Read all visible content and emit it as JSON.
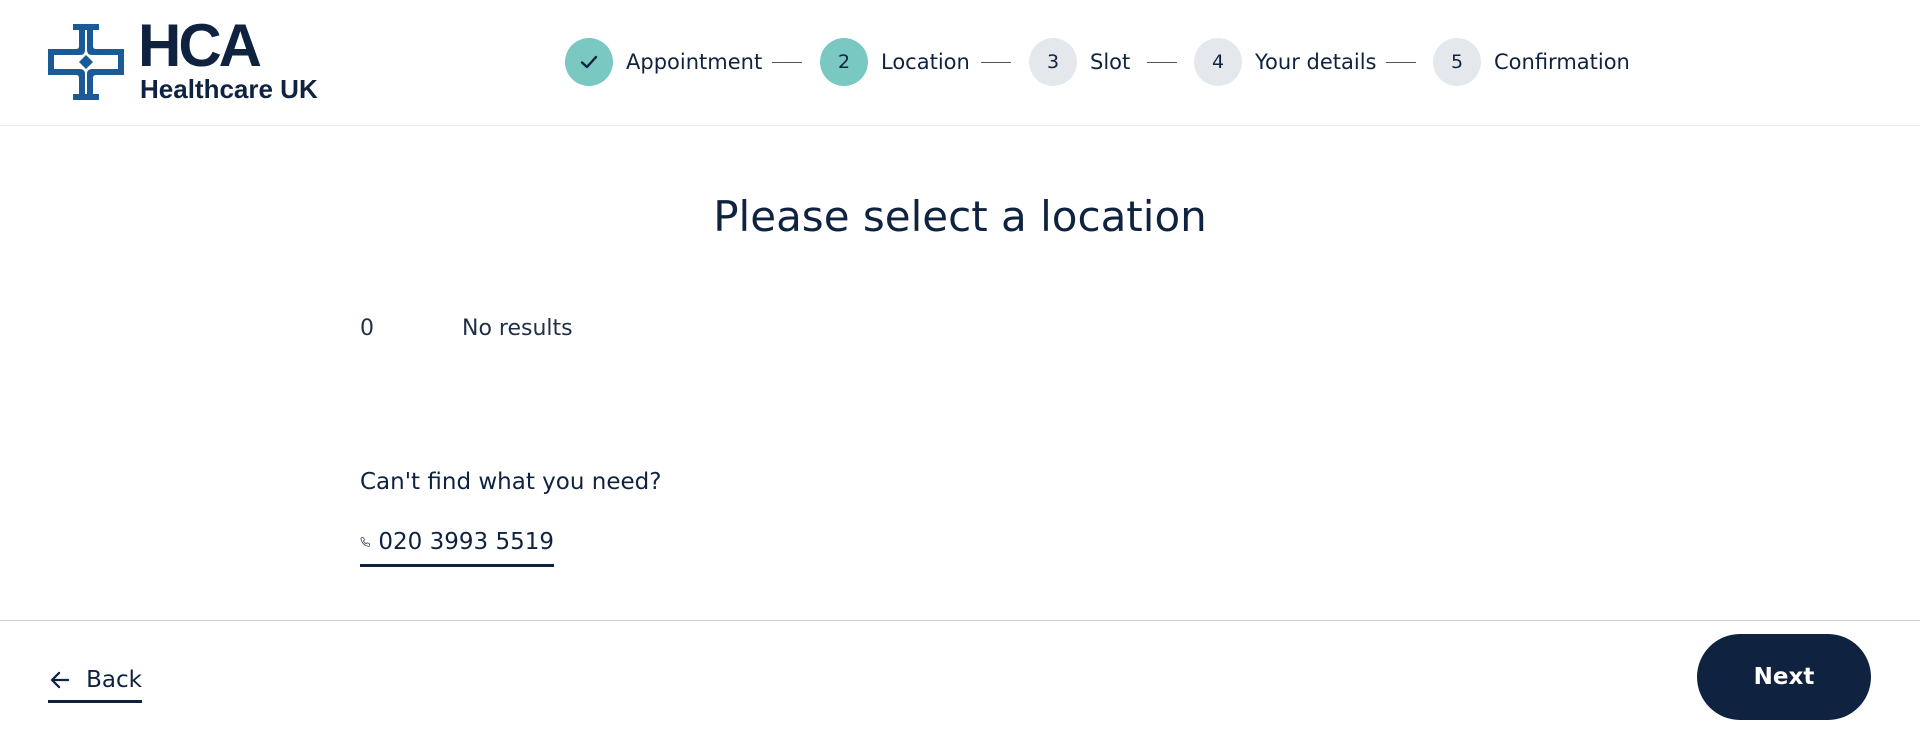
{
  "brand": {
    "name": "HCA",
    "subtitle": "Healthcare UK",
    "primary_color": "#0f2340",
    "logo_color": "#1a5a96",
    "accent_color": "#79c8c1",
    "pending_color": "#e4e8ec"
  },
  "stepper": {
    "steps": [
      {
        "label": "Appointment",
        "status": "complete",
        "icon": "check-icon"
      },
      {
        "number": "2",
        "label": "Location",
        "status": "active"
      },
      {
        "number": "3",
        "label": "Slot",
        "status": "pending"
      },
      {
        "number": "4",
        "label": "Your details",
        "status": "pending"
      },
      {
        "number": "5",
        "label": "Confirmation",
        "status": "pending"
      }
    ]
  },
  "main": {
    "title": "Please select a location",
    "results_count": "0",
    "results_text": "No results",
    "help_heading": "Can't find what you need?",
    "phone_number": "020 3993 5519",
    "phone_icon": "phone-icon"
  },
  "footer": {
    "back_label": "Back",
    "back_icon": "arrow-left-icon",
    "next_label": "Next"
  }
}
